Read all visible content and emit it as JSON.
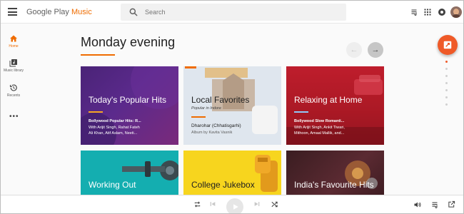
{
  "app": {
    "logo_prefix": "Google Play ",
    "logo_accent": "Music"
  },
  "search": {
    "placeholder": "Search"
  },
  "sidebar": {
    "items": [
      {
        "label": "Home",
        "icon": "home-icon",
        "active": true
      },
      {
        "label": "Music library",
        "icon": "music-library-icon",
        "active": false
      },
      {
        "label": "Recents",
        "icon": "recents-icon",
        "active": false
      }
    ],
    "more": "•••"
  },
  "main": {
    "section_title": "Monday evening",
    "prev_glyph": "←",
    "next_glyph": "→"
  },
  "cards": [
    {
      "title": "Today's Popular Hits",
      "line1": "Bollywood Popular Hits: R...",
      "line2": "With Arijit Singh, Rahat Fateh",
      "line3": "Ali Khan, Atif Aslam, Neeti..."
    },
    {
      "title": "Local Favorites",
      "subtitle": "Popular in Indore",
      "line1": "Dharohar (Chhatisgarhi)",
      "line2": "Album by Kavita Vasnik"
    },
    {
      "title": "Relaxing at Home",
      "line1": "Bollywood Slow Romanti...",
      "line2": "With Arijit Singh, Ankit Tiwari,",
      "line3": "Mithoon, Amaal Mallik, and..."
    },
    {
      "title": "Working Out"
    },
    {
      "title": "College Jukebox"
    },
    {
      "title": "India's Favourite Hits"
    }
  ],
  "colors": {
    "accent": "#ef6c00",
    "fab": "#ef5a28",
    "card1_bg": "#4a2377",
    "card3_bg": "#a31822",
    "card4_bg": "#14aeb0",
    "card5_bg": "#f7d51e",
    "card6_bg": "#5b2a32"
  },
  "pager": {
    "total": 7,
    "active_index": 0
  }
}
